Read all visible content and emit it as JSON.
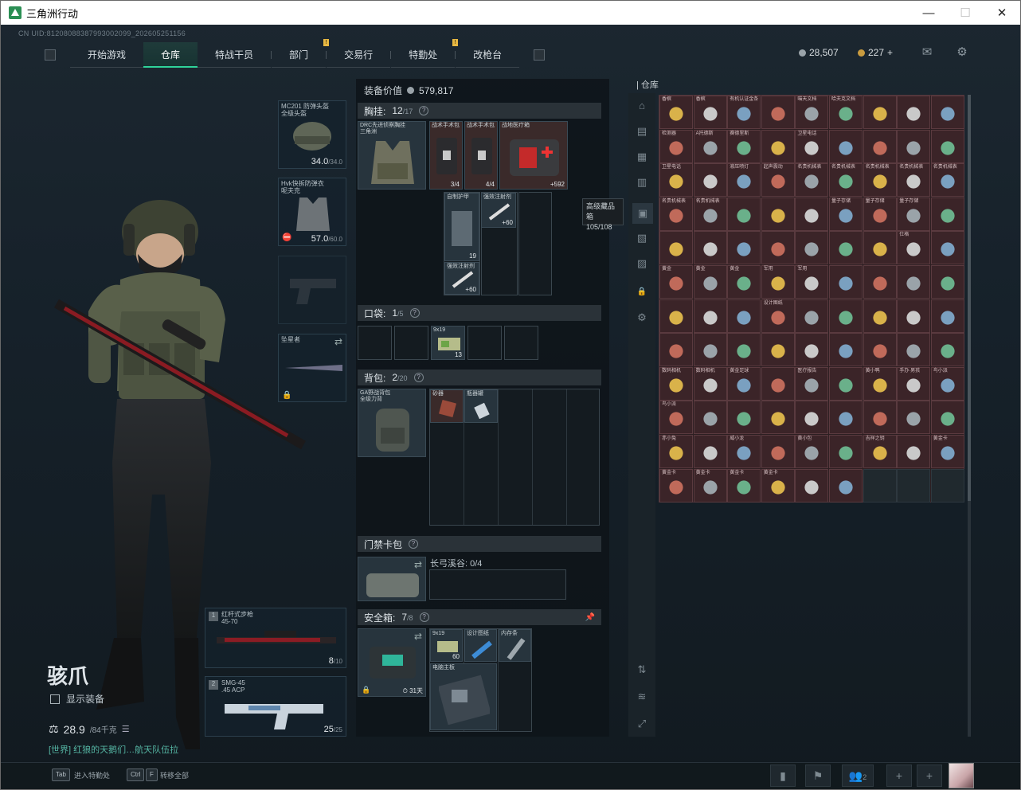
{
  "window": {
    "title": "三角洲行动",
    "minimize": "—",
    "maximize": "☐",
    "close": "✕"
  },
  "uid": "CN UID:812080883879930020​99_202605251156",
  "nav": {
    "tabs": [
      {
        "label": "开始游戏",
        "badge": ""
      },
      {
        "label": "仓库",
        "badge": ""
      },
      {
        "label": "特战干员",
        "badge": ""
      },
      {
        "label": "部门",
        "badge": "!"
      },
      {
        "label": "交易行",
        "badge": ""
      },
      {
        "label": "特勤处",
        "badge": "!"
      },
      {
        "label": "改枪台",
        "badge": ""
      }
    ],
    "active": 1
  },
  "currency": {
    "silver": "28,507",
    "gold": "227",
    "plus": "+"
  },
  "colors": {
    "accent": "#2fd39a",
    "warehouse_bg": "#3b2428",
    "gold": "#d9b24a"
  },
  "character": {
    "name": "骇爪",
    "show_equipment": "显示装备",
    "weight": "28.9",
    "weight_max": "/84千克",
    "chat": "[世界] 红狼的天鹅们…航天队伍拉"
  },
  "equip": {
    "helmet": {
      "label": "MC201 防弹头盔",
      "sub": "全级头盔",
      "value": "34.0",
      "max": "/34.0"
    },
    "armor": {
      "label": "Hvk快拆防弹衣",
      "sub": "呢夫克",
      "value": "57.0",
      "max": "/60.0"
    },
    "melee": {
      "label": "坠星者"
    },
    "primary": {
      "slot": "1",
      "label": "红杆式步枪",
      "sub": "45-70",
      "ammo": "8",
      "ammo_max": "/10"
    },
    "secondary": {
      "slot": "2",
      "label": "SMG-45",
      "sub": ".45 ACP",
      "ammo": "25",
      "ammo_max": "/25"
    }
  },
  "loadout": {
    "value_label": "装备价值",
    "value": "579,817",
    "chest": {
      "label": "胸挂:",
      "count": "12",
      "max": "/17",
      "items": [
        {
          "name": "DRC先进侦察胸挂",
          "sub": "三角洲"
        },
        {
          "name": "战术手术包",
          "count": "3/4"
        },
        {
          "name": "战术手术包",
          "count": "4/4"
        },
        {
          "name": "战地医疗箱",
          "count": "+592"
        },
        {
          "name": "自制护甲",
          "count": "19"
        },
        {
          "name": "强效注射剂",
          "count": "+60"
        },
        {
          "name": "强效注射剂",
          "count": "+60"
        }
      ]
    },
    "pocket": {
      "label": "口袋:",
      "count": "1",
      "max": "/5",
      "item": {
        "name": "9x19",
        "count": "13"
      }
    },
    "backpack": {
      "label": "背包:",
      "count": "2",
      "max": "/20",
      "items": [
        {
          "name": "GA野战背包",
          "sub": "全级力背"
        },
        {
          "name": "砂器"
        },
        {
          "name": "瓶器罐"
        }
      ]
    },
    "keycard": {
      "label": "门禁卡包",
      "slot_label": "长弓溪谷: 0/4"
    },
    "safebox": {
      "label": "安全箱:",
      "count": "7",
      "max": "/8",
      "timer": "31天",
      "items": [
        {
          "name": "9x19",
          "count": "60"
        },
        {
          "name": "设计图纸"
        },
        {
          "name": "内存条"
        },
        {
          "name": "电脑主板"
        }
      ]
    }
  },
  "tooltip": {
    "title": "高级藏品箱",
    "value": "105/108"
  },
  "warehouse": {
    "title": "仓库",
    "rows": [
      [
        "香槟",
        "香槟",
        "有机认证金条",
        "",
        "喵天文档",
        "哈夫克文档"
      ],
      [
        "检测器",
        "A托德斯",
        "赛德里斯",
        "",
        "卫星电话",
        ""
      ],
      [
        "卫星电话",
        "",
        "液压喷灯",
        "起声震动",
        "名贵机械表",
        "名贵机械表",
        "名贵机械表",
        "名贵机械表",
        "名贵机械表"
      ],
      [
        "名贵机械表",
        "名贵机械表",
        "",
        "",
        "",
        "量子存储",
        "量子存储",
        "量子存储",
        ""
      ],
      [
        "",
        "",
        "",
        "",
        "",
        "",
        "",
        "仕格",
        ""
      ],
      [
        "黄金",
        "黄金",
        "黄金",
        "军用",
        "军用",
        "",
        "",
        "",
        ""
      ],
      [
        "",
        "",
        "",
        "设计图纸",
        "",
        "",
        "",
        "",
        ""
      ],
      [
        "",
        "",
        "",
        "",
        "",
        "",
        "",
        "",
        ""
      ],
      [
        "数码相机",
        "数码相机",
        "黄金足球",
        "",
        "医疗报告",
        "",
        "黄小鸭",
        "手办·男孩",
        "鸟小派"
      ],
      [
        "鸟小派",
        "",
        "",
        "",
        "",
        "",
        "",
        "",
        ""
      ],
      [
        "赤小兔",
        "",
        "威小龙",
        "",
        "黄小包",
        "",
        "吉祥之钥",
        "",
        "黄金卡"
      ],
      [
        "黄金卡",
        "黄金卡",
        "黄金卡",
        "黄金卡",
        "",
        "",
        "",
        "",
        ""
      ]
    ]
  },
  "bottom": {
    "tab_key": "Tab",
    "tab_label": "进入特勤处",
    "ctrl_key": "Ctrl",
    "f_key": "F",
    "ctrl_label": "转移全部",
    "party": "2"
  }
}
